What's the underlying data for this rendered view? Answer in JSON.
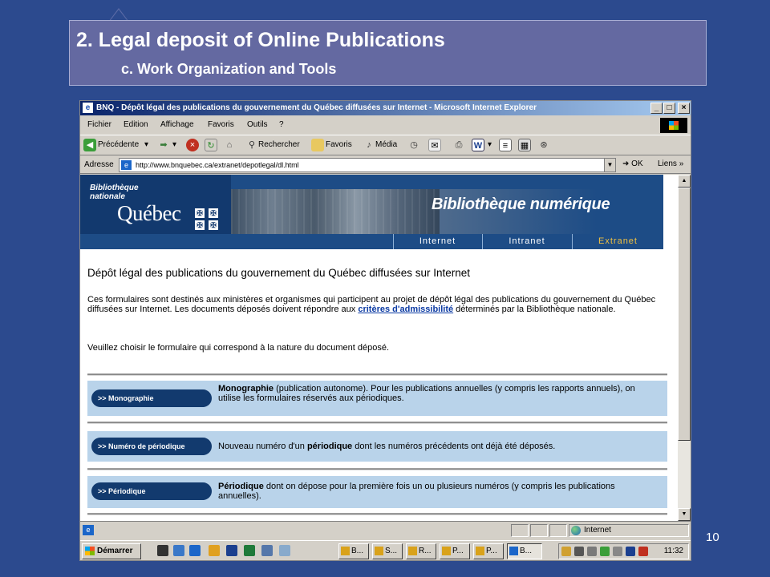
{
  "slide": {
    "title": "2. Legal deposit of Online Publications",
    "subtitle": "c. Work Organization and Tools",
    "page_number": "10"
  },
  "browser": {
    "window_title": "BNQ - Dépôt légal des publications du gouvernement du Québec diffusées sur Internet - Microsoft Internet Explorer",
    "window_buttons": [
      "_",
      "□",
      "×"
    ],
    "menu": [
      "Fichier",
      "Edition",
      "Affichage",
      "Favoris",
      "Outils",
      "?"
    ],
    "toolbar": {
      "back": "Précédente",
      "search": "Rechercher",
      "favorites": "Favoris",
      "media": "Média"
    },
    "address": {
      "label": "Adresse",
      "url": "http://www.bnquebec.ca/extranet/depotlegal/dl.html",
      "go": "OK",
      "links": "Liens"
    }
  },
  "page": {
    "banner": {
      "org_line1": "Bibliothèque",
      "org_line2": "nationale",
      "org_quebec": "Québec",
      "title": "Bibliothèque numérique",
      "nav": [
        "Internet",
        "Intranet",
        "Extranet"
      ]
    },
    "heading": "Dépôt légal des publications du gouvernement du Québec diffusées sur Internet",
    "intro_before_link": "Ces formulaires sont destinés aux ministères et organismes qui participent au projet de dépôt légal des publications du gouvernement du Québec diffusées sur Internet. Les documents déposés doivent répondre aux ",
    "intro_link": "critères d'admissibilité",
    "intro_after_link": " déterminés par la Bibliothèque nationale.",
    "choose_text": "Veuillez choisir le formulaire qui correspond à la nature du document déposé.",
    "forms": [
      {
        "button": ">> Monographie",
        "bold": "Monographie",
        "text": " (publication autonome). Pour les publications annuelles (y compris les rapports annuels), on utilise les formulaires réservés aux périodiques."
      },
      {
        "button": ">> Numéro de périodique",
        "pre": "Nouveau numéro d'un ",
        "bold": "périodique",
        "text": " dont les numéros précédents ont déjà été déposés."
      },
      {
        "button": ">> Périodique",
        "bold": "Périodique",
        "text": " dont on dépose pour la première fois un ou plusieurs numéros (y compris les publications annuelles)."
      }
    ]
  },
  "status": {
    "zone": "Internet"
  },
  "taskbar": {
    "start": "Démarrer",
    "tasks": [
      "B...",
      "S...",
      "R...",
      "P...",
      "P...",
      "B..."
    ],
    "clock": "11:32"
  },
  "colors": {
    "slide_bg": "#2c4a8e",
    "title_box": "#6469a1",
    "banner": "#1d4c86",
    "row_bg": "#b9d3ea",
    "pill": "#123a6e"
  }
}
